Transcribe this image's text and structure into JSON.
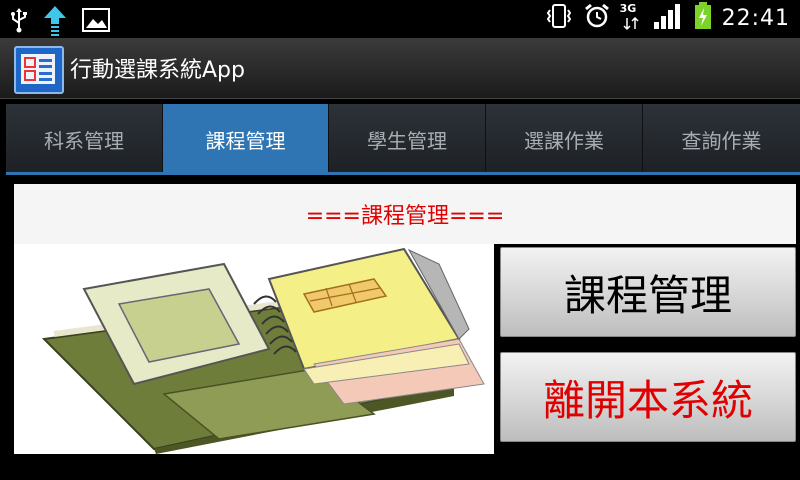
{
  "status_bar": {
    "time": "22:41",
    "network": "3G",
    "icons": [
      "usb-icon",
      "upload-icon",
      "image-icon",
      "vibrate-icon",
      "alarm-icon",
      "signal-icon",
      "battery-charging-icon"
    ]
  },
  "app": {
    "title": "行動選課系統App"
  },
  "tabs": [
    {
      "label": "科系管理",
      "active": false
    },
    {
      "label": "課程管理",
      "active": true
    },
    {
      "label": "學生管理",
      "active": false
    },
    {
      "label": "選課作業",
      "active": false
    },
    {
      "label": "查詢作業",
      "active": false
    }
  ],
  "page": {
    "header": "===課程管理===",
    "course_button_label": "課程管理",
    "exit_button_label": "離開本系統"
  },
  "colors": {
    "accent": "#2f74b3",
    "header_text": "#e00000",
    "exit_text": "#e00000"
  }
}
